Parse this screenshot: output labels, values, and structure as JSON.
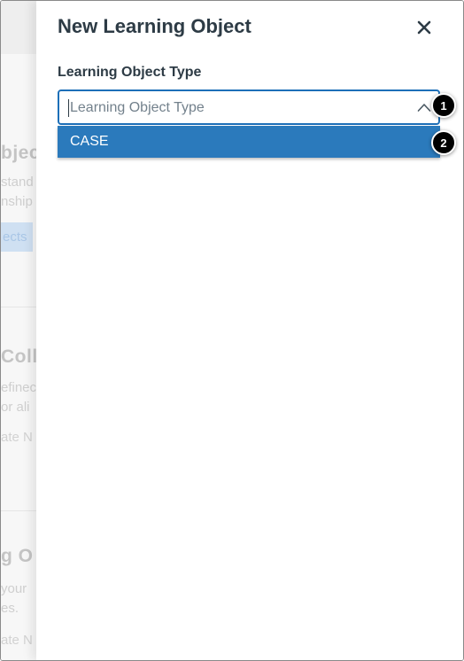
{
  "background_page": {
    "section1": {
      "heading": "bjec",
      "lines": [
        "stand",
        "nship"
      ],
      "button": "ects"
    },
    "section2": {
      "heading": "Colle",
      "lines": [
        "efinec",
        "or ali"
      ],
      "link": "ate N"
    },
    "section3": {
      "heading": "g O",
      "lines": [
        "your",
        "es."
      ],
      "link": "ate N"
    }
  },
  "drawer": {
    "title": "New Learning Object",
    "close_icon": "close-icon",
    "field_label": "Learning Object Type",
    "select": {
      "placeholder": "Learning Object Type",
      "value": "",
      "expanded": true,
      "chevron_icon": "chevron-up-icon"
    },
    "options": [
      "CASE"
    ]
  },
  "callouts": [
    "1",
    "2"
  ],
  "colors": {
    "title_text": "#2d3b45",
    "focus_border": "#1d6fb8",
    "option_highlight": "#2b7abc",
    "callout_bg": "#000000"
  }
}
